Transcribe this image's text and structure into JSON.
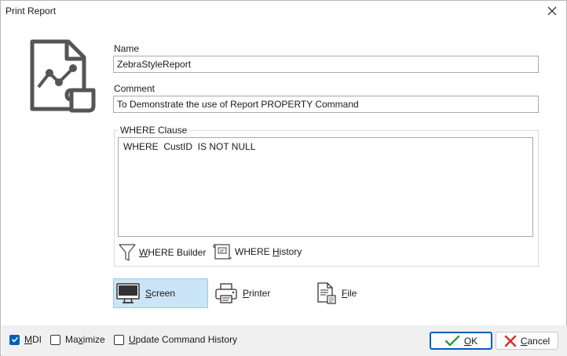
{
  "window": {
    "title": "Print Report"
  },
  "form": {
    "name_label": "Name",
    "name_value": "ZebraStyleReport",
    "comment_label": "Comment",
    "comment_value": "To Demonstrate the use of Report PROPERTY Command",
    "where_label": "WHERE Clause",
    "where_value": "WHERE  CustID  IS NOT NULL"
  },
  "where_tools": {
    "builder": {
      "accel": "W",
      "rest": "HERE Builder"
    },
    "history": {
      "pre": "WHERE ",
      "accel": "H",
      "rest": "istory"
    }
  },
  "output": {
    "screen": {
      "accel": "S",
      "rest": "creen",
      "selected": true
    },
    "printer": {
      "accel": "P",
      "rest": "rinter"
    },
    "file": {
      "accel": "F",
      "rest": "ile"
    }
  },
  "options": {
    "mdi": {
      "accel": "M",
      "rest": "DI",
      "checked": true
    },
    "maximize": {
      "pre": "Ma",
      "accel": "x",
      "rest": "imize",
      "checked": false
    },
    "update_history": {
      "accel": "U",
      "rest": "pdate Command History",
      "checked": false
    }
  },
  "buttons": {
    "ok": {
      "accel": "O",
      "rest": "K"
    },
    "cancel": {
      "accel": "C",
      "rest": "ancel"
    }
  },
  "colors": {
    "accent": "#005fb8",
    "selected_bg": "#cce4f7",
    "cancel_x": "#d92b2b",
    "ok_check": "#2e9b35"
  }
}
